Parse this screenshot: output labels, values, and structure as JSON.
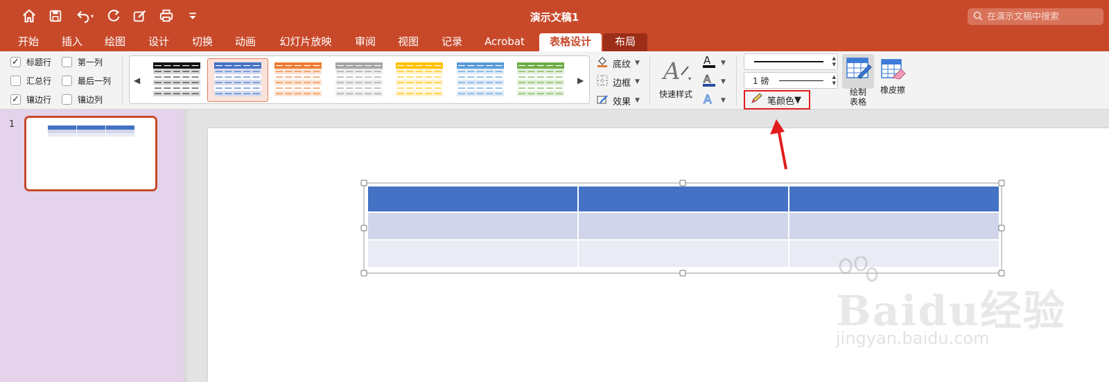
{
  "app": {
    "title": "演示文稿1",
    "search_placeholder": "在演示文稿中搜索",
    "accent": "#c8492a"
  },
  "quick_access": [
    "home-icon",
    "save-icon",
    "undo-icon",
    "redo-icon",
    "edit-icon",
    "print-icon",
    "customize-icon"
  ],
  "tabs": [
    {
      "label": "开始"
    },
    {
      "label": "插入"
    },
    {
      "label": "绘图"
    },
    {
      "label": "设计"
    },
    {
      "label": "切换"
    },
    {
      "label": "动画"
    },
    {
      "label": "幻灯片放映"
    },
    {
      "label": "审阅"
    },
    {
      "label": "视图"
    },
    {
      "label": "记录"
    },
    {
      "label": "Acrobat"
    },
    {
      "label": "表格设计"
    },
    {
      "label": "布局"
    }
  ],
  "active_tab": "表格设计",
  "table_style_options": [
    {
      "label": "标题行",
      "checked": true
    },
    {
      "label": "汇总行",
      "checked": false
    },
    {
      "label": "镶边行",
      "checked": true
    },
    {
      "label": "第一列",
      "checked": false
    },
    {
      "label": "最后一列",
      "checked": false
    },
    {
      "label": "镶边列",
      "checked": false
    }
  ],
  "table_styles_gallery": {
    "styles": [
      {
        "header": "#111111",
        "band": "#d9d9d9",
        "line": "#333333"
      },
      {
        "header": "#4472c4",
        "band": "#d5dcef",
        "line": "#4472c4",
        "selected": true
      },
      {
        "header": "#ed7d31",
        "band": "#fbe3d3",
        "line": "#ed7d31"
      },
      {
        "header": "#a5a5a5",
        "band": "#ededed",
        "line": "#999999"
      },
      {
        "header": "#ffc000",
        "band": "#fff2cc",
        "line": "#ffc000"
      },
      {
        "header": "#5b9bd5",
        "band": "#deebf7",
        "line": "#5b9bd5"
      },
      {
        "header": "#70ad47",
        "band": "#e2efda",
        "line": "#70ad47"
      }
    ]
  },
  "shading_group": {
    "shading": "底纹",
    "borders": "边框",
    "effects": "效果"
  },
  "wordart": {
    "quick_styles": "快速样式"
  },
  "draw_borders": {
    "pen_weight": "1 磅",
    "pen_color": "笔颜色",
    "draw_table": "绘制\n表格",
    "eraser": "橡皮擦"
  },
  "slides": [
    {
      "number": "1",
      "selected": true
    }
  ],
  "slide_table": {
    "rows": 3,
    "cols": 3,
    "header_color": "#4472c4",
    "band1_color": "#d0d5ea",
    "band2_color": "#e9ebf5"
  },
  "annotation": {
    "arrow_color": "#e21c1c",
    "highlight": "pen_color"
  },
  "watermark": {
    "brand": "Baidu经验",
    "url": "jingyan.baidu.com"
  }
}
